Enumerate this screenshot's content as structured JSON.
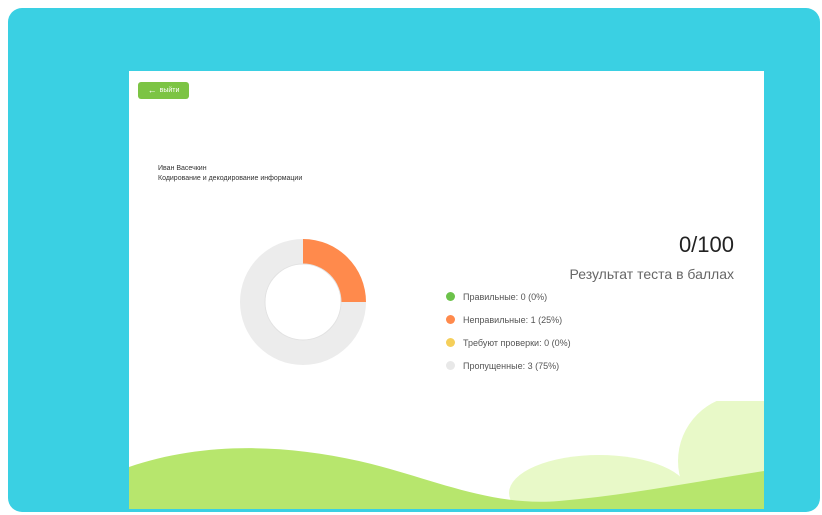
{
  "exit_button": {
    "label": "выйти",
    "icon": "arrow-left-icon"
  },
  "user": {
    "name": "Иван Васечкин",
    "topic": "Кодирование и декодирование информации"
  },
  "result": {
    "score": "0/100",
    "caption": "Результат теста в баллах"
  },
  "legend": [
    {
      "label": "Правильные: 0 (0%)",
      "color": "#6cc24a"
    },
    {
      "label": "Неправильные: 1 (25%)",
      "color": "#ff8a4c"
    },
    {
      "label": "Требуют проверки: 0 (0%)",
      "color": "#f5cf5a"
    },
    {
      "label": "Пропущенные: 3 (75%)",
      "color": "#e8e8e8"
    }
  ],
  "donut": {
    "segments": [
      {
        "name": "Правильные",
        "fraction": 0,
        "color": "#6cc24a"
      },
      {
        "name": "Неправильные",
        "fraction": 0.25,
        "color": "#ff8a4c"
      },
      {
        "name": "Требуют проверки",
        "fraction": 0,
        "color": "#f5cf5a"
      },
      {
        "name": "Пропущенные",
        "fraction": 0.75,
        "color": "#ececec"
      }
    ]
  },
  "colors": {
    "frame": "#3ad0e3",
    "button": "#7cc444",
    "wave_main": "#b7e66d",
    "wave_light": "#e8f9c8"
  }
}
